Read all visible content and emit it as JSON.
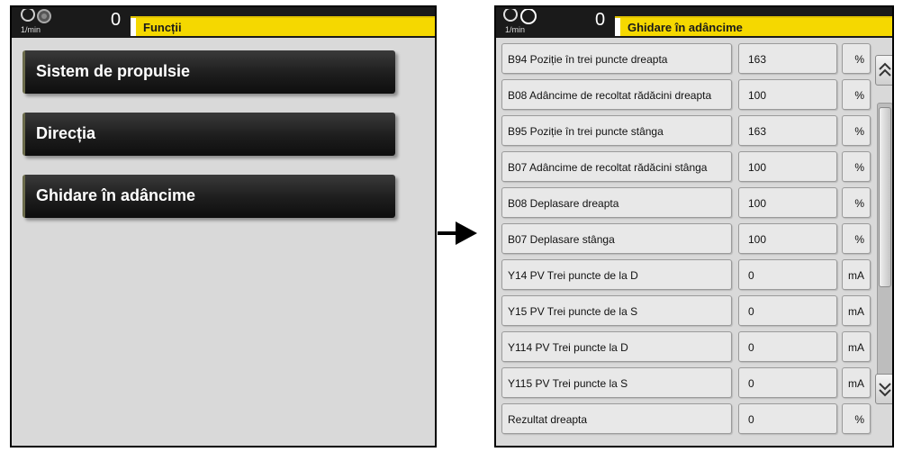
{
  "left_screen": {
    "header": {
      "rpm_unit": "1/min",
      "rpm_value": "0",
      "title": "Funcții",
      "icon": "rpm-gauge-icon"
    },
    "menu": [
      {
        "label": "Sistem de propulsie"
      },
      {
        "label": "Direcția"
      },
      {
        "label": "Ghidare în adâncime"
      }
    ]
  },
  "arrow_icon": "right-arrow-icon",
  "right_screen": {
    "header": {
      "rpm_unit": "1/min",
      "rpm_value": "0",
      "title": "Ghidare în adâncime",
      "icon": "rpm-gauge-icon"
    },
    "rows": [
      {
        "label": "B94 Poziție în trei puncte dreapta",
        "value": "163",
        "unit": "%"
      },
      {
        "label": "B08 Adâncime de recoltat rădăcini dreapta",
        "value": "100",
        "unit": "%"
      },
      {
        "label": "B95 Poziție în trei puncte stânga",
        "value": "163",
        "unit": "%"
      },
      {
        "label": "B07 Adâncime de recoltat rădăcini stânga",
        "value": "100",
        "unit": "%"
      },
      {
        "label": "B08 Deplasare dreapta",
        "value": "100",
        "unit": "%"
      },
      {
        "label": "B07 Deplasare stânga",
        "value": "100",
        "unit": "%"
      },
      {
        "label": "Y14 PV Trei puncte de la D",
        "value": "0",
        "unit": "mA"
      },
      {
        "label": "Y15 PV Trei puncte de la S",
        "value": "0",
        "unit": "mA"
      },
      {
        "label": "Y114 PV Trei puncte la D",
        "value": "0",
        "unit": "mA"
      },
      {
        "label": "Y115 PV Trei puncte la S",
        "value": "0",
        "unit": "mA"
      },
      {
        "label": "Rezultat dreapta",
        "value": "0",
        "unit": "%"
      }
    ],
    "scroll_up_icon": "chevron-double-up-icon",
    "scroll_down_icon": "chevron-double-down-icon"
  },
  "colors": {
    "title_bar": "#f5d800",
    "panel_bg": "#d9d9d9",
    "button_dark": "#1d1d1d"
  }
}
